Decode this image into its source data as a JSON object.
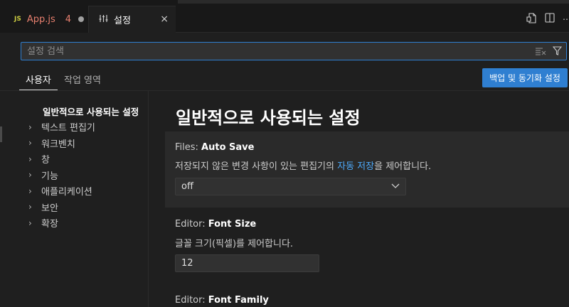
{
  "tabs": [
    {
      "badge": "JS",
      "name": "App.js",
      "count": "4"
    },
    {
      "name": "설정",
      "close": "×"
    }
  ],
  "search": {
    "placeholder": "설정 검색"
  },
  "scope_tabs": {
    "user": "사용자",
    "workspace": "작업 영역"
  },
  "sync_button": "백업 및 동기화 설정",
  "toc": {
    "header": "일반적으로 사용되는 설정",
    "items": [
      "텍스트 편집기",
      "워크벤치",
      "창",
      "기능",
      "애플리케이션",
      "보안",
      "확장"
    ]
  },
  "main": {
    "section_title": "일반적으로 사용되는 설정",
    "settings": [
      {
        "category": "Files: ",
        "name": "Auto Save",
        "desc_before": "저장되지 않은 변경 사항이 있는 편집기의 ",
        "desc_link": "자동 저장",
        "desc_after": "을 제어합니다.",
        "value": "off"
      },
      {
        "category": "Editor: ",
        "name": "Font Size",
        "desc": "글꼴 크기(픽셀)를 제어합니다.",
        "value": "12"
      },
      {
        "category": "Editor: ",
        "name": "Font Family"
      }
    ]
  },
  "colors": {
    "accent": "#2f7fd1",
    "link": "#4daafc",
    "background": "#1f1f1f"
  }
}
